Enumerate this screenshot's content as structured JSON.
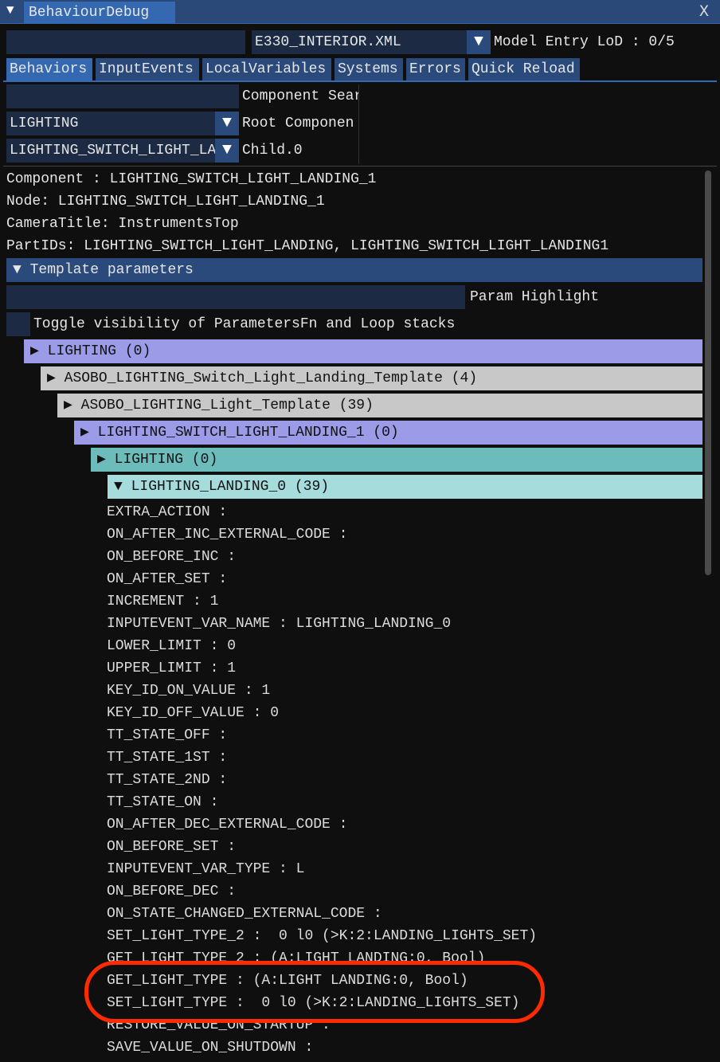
{
  "window": {
    "title": "BehaviourDebug",
    "close": "X"
  },
  "top": {
    "file": "E330_INTERIOR.XML",
    "lod": "Model Entry LoD : 0/5",
    "search_value": ""
  },
  "tabs": [
    "Behaviors",
    "InputEvents",
    "LocalVariables",
    "Systems",
    "Errors",
    "Quick Reload"
  ],
  "filters": {
    "component_search_label": "Component Sear",
    "root_value": "LIGHTING",
    "root_label": "Root Componen",
    "child_value": "LIGHTING_SWITCH_LIGHT_LA",
    "child_label": "Child.0"
  },
  "info": [
    "Component : LIGHTING_SWITCH_LIGHT_LANDING_1",
    "Node: LIGHTING_SWITCH_LIGHT_LANDING_1",
    "CameraTitle: InstrumentsTop",
    "PartIDs: LIGHTING_SWITCH_LIGHT_LANDING, LIGHTING_SWITCH_LIGHT_LANDING1"
  ],
  "template_header": "Template parameters",
  "param_highlight_label": "Param Highlight",
  "toggle_label": "Toggle visibility of ParametersFn and Loop stacks",
  "tree": [
    {
      "label": "LIGHTING (0)",
      "color": "#9b9be8",
      "open": false
    },
    {
      "label": "ASOBO_LIGHTING_Switch_Light_Landing_Template (4)",
      "color": "#c8c8c8",
      "open": false
    },
    {
      "label": "ASOBO_LIGHTING_Light_Template (39)",
      "color": "#c8c8c8",
      "open": false
    },
    {
      "label": "LIGHTING_SWITCH_LIGHT_LANDING_1 (0)",
      "color": "#9b9be8",
      "open": false
    },
    {
      "label": "LIGHTING (0)",
      "color": "#6dbcbc",
      "open": false
    },
    {
      "label": "LIGHTING_LANDING_0 (39)",
      "color": "#a6dcdc",
      "open": true
    }
  ],
  "params": [
    "EXTRA_ACTION :",
    "ON_AFTER_INC_EXTERNAL_CODE :",
    "ON_BEFORE_INC :",
    "ON_AFTER_SET :",
    "INCREMENT : 1",
    "INPUTEVENT_VAR_NAME : LIGHTING_LANDING_0",
    "LOWER_LIMIT : 0",
    "UPPER_LIMIT : 1",
    "KEY_ID_ON_VALUE : 1",
    "KEY_ID_OFF_VALUE : 0",
    "TT_STATE_OFF :",
    "TT_STATE_1ST :",
    "TT_STATE_2ND :",
    "TT_STATE_ON :",
    "ON_AFTER_DEC_EXTERNAL_CODE :",
    "ON_BEFORE_SET :",
    "INPUTEVENT_VAR_TYPE : L",
    "ON_BEFORE_DEC :",
    "ON_STATE_CHANGED_EXTERNAL_CODE :",
    "SET_LIGHT_TYPE_2 :  0 l0 (>K:2:LANDING_LIGHTS_SET)",
    "GET_LIGHT_TYPE_2 : (A:LIGHT LANDING:0, Bool)",
    "GET_LIGHT_TYPE : (A:LIGHT LANDING:0, Bool)",
    "SET_LIGHT_TYPE :  0 l0 (>K:2:LANDING_LIGHTS_SET)",
    "RESTORE_VALUE_ON_STARTUP :",
    "SAVE_VALUE_ON_SHUTDOWN :"
  ],
  "colors": {
    "highlight_circle": "#ff2a00",
    "accent": "#3468b0"
  }
}
